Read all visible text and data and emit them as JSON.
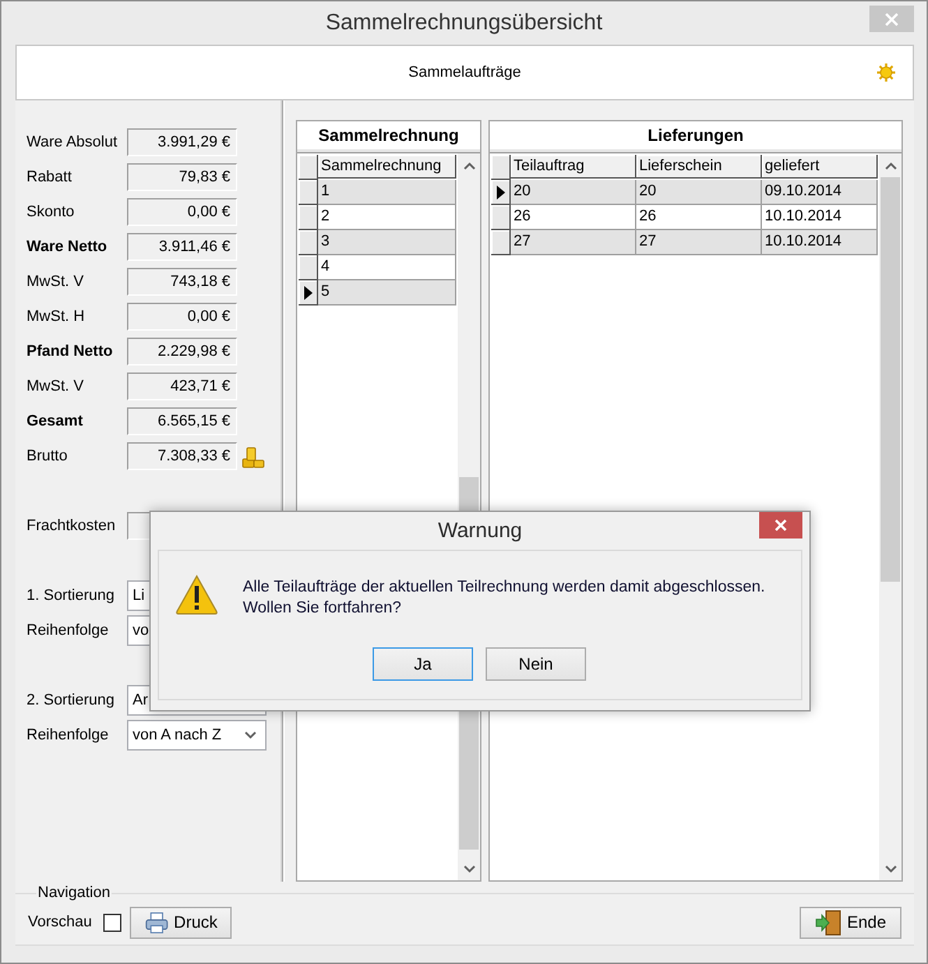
{
  "window": {
    "title": "Sammelrechnungsübersicht"
  },
  "header": {
    "title": "Sammelaufträge"
  },
  "totals": [
    {
      "label": "Ware Absolut",
      "value": "3.991,29 €",
      "bold": false,
      "kind": "amount"
    },
    {
      "label": "Rabatt",
      "value": "79,83 €",
      "bold": false,
      "kind": "amount"
    },
    {
      "label": "Skonto",
      "value": "0,00 €",
      "bold": false,
      "kind": "amount"
    },
    {
      "label": "Ware Netto",
      "value": "3.911,46 €",
      "bold": true,
      "kind": "amount"
    },
    {
      "label": "MwSt. V",
      "value": "743,18 €",
      "bold": false,
      "kind": "amount"
    },
    {
      "label": "MwSt. H",
      "value": "0,00 €",
      "bold": false,
      "kind": "amount"
    },
    {
      "label": "Pfand Netto",
      "value": "2.229,98 €",
      "bold": true,
      "kind": "amount"
    },
    {
      "label": "MwSt. V",
      "value": "423,71 €",
      "bold": false,
      "kind": "amount"
    },
    {
      "label": "Gesamt",
      "value": "6.565,15 €",
      "bold": true,
      "kind": "amount"
    },
    {
      "label": "Brutto",
      "value": "7.308,33 €",
      "bold": false,
      "kind": "amount_with_coins"
    }
  ],
  "freight": {
    "label": "Frachtkosten"
  },
  "sortings": [
    {
      "sort_label": "1. Sortierung",
      "sort_value": "Li",
      "order_label": "Reihenfolge",
      "order_value": "vo"
    },
    {
      "sort_label": "2. Sortierung",
      "sort_value": "Ar",
      "order_label": "Reihenfolge",
      "order_value": "von A nach Z"
    }
  ],
  "invoices": {
    "title": "Sammelrechnung",
    "columns": [
      "Sammelrechnung"
    ],
    "rows": [
      {
        "cells": [
          "1"
        ],
        "current": false
      },
      {
        "cells": [
          "2"
        ],
        "current": false
      },
      {
        "cells": [
          "3"
        ],
        "current": false
      },
      {
        "cells": [
          "4"
        ],
        "current": false
      },
      {
        "cells": [
          "5"
        ],
        "current": true
      }
    ]
  },
  "deliveries": {
    "title": "Lieferungen",
    "columns": [
      "Teilauftrag",
      "Lieferschein",
      "geliefert"
    ],
    "rows": [
      {
        "cells": [
          "20",
          "20",
          "09.10.2014"
        ],
        "current": true
      },
      {
        "cells": [
          "26",
          "26",
          "10.10.2014"
        ],
        "current": false
      },
      {
        "cells": [
          "27",
          "27",
          "10.10.2014"
        ],
        "current": false
      }
    ]
  },
  "navigation": {
    "title": "Navigation",
    "preview": {
      "label": "Vorschau",
      "checked": false
    },
    "print_button": "Druck",
    "end_button": "Ende"
  },
  "dialog": {
    "title": "Warnung",
    "message": "Alle Teilaufträge der aktuellen Teilrechnung werden damit abgeschlossen.\nWollen Sie fortfahren?",
    "buttons": [
      {
        "label": "Ja",
        "default": true
      },
      {
        "label": "Nein",
        "default": false
      }
    ]
  }
}
